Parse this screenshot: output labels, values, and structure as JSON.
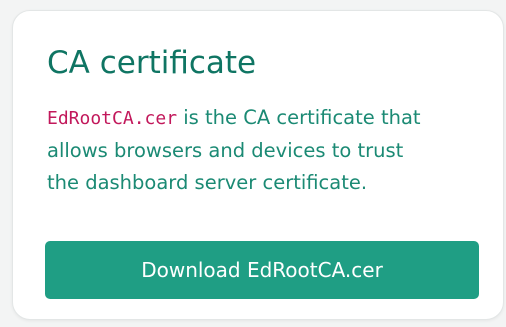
{
  "card": {
    "title": "CA certificate",
    "description": {
      "filename": "EdRootCA.cer",
      "line_1": " is the CA certificate that",
      "line_2": "allows browsers and devices to trust",
      "line_3": "the dashboard server certificate."
    },
    "download_label": "Download EdRootCA.cer"
  },
  "colors": {
    "accent": "#1f9e84",
    "heading": "#0f7563",
    "text": "#1b8a74",
    "code": "#c2185b",
    "background": "#f3f4f4",
    "card": "#ffffff"
  }
}
